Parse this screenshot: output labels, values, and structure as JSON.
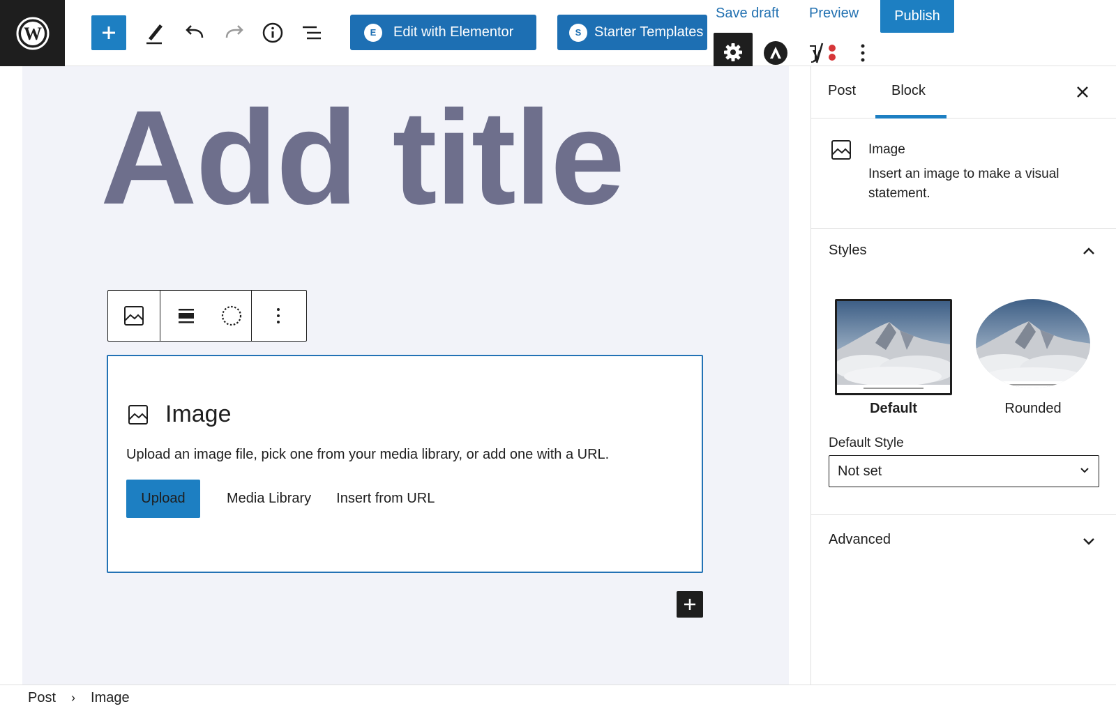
{
  "toolbar": {
    "elementor_label": "Edit with Elementor",
    "starter_label": "Starter Templates",
    "save_draft_label": "Save draft",
    "preview_label": "Preview",
    "publish_label": "Publish"
  },
  "editor": {
    "title_placeholder": "Add title",
    "image_block": {
      "title": "Image",
      "description": "Upload an image file, pick one from your media library, or add one with a URL.",
      "upload_label": "Upload",
      "media_library_label": "Media Library",
      "insert_url_label": "Insert from URL"
    }
  },
  "sidebar": {
    "tabs": [
      {
        "label": "Post",
        "active": false
      },
      {
        "label": "Block",
        "active": true
      }
    ],
    "block_card": {
      "title": "Image",
      "description": "Insert an image to make a visual statement."
    },
    "styles": {
      "title": "Styles",
      "options": [
        {
          "label": "Default",
          "selected": true
        },
        {
          "label": "Rounded",
          "selected": false
        }
      ],
      "default_style_label": "Default Style",
      "default_style_value": "Not set"
    },
    "advanced": {
      "title": "Advanced"
    }
  },
  "breadcrumb": [
    "Post",
    "Image"
  ],
  "colors": {
    "accent": "#1d7fc2",
    "dark": "#1e1e1e",
    "canvas": "#f2f3f9",
    "title": "#6e6f8c"
  }
}
